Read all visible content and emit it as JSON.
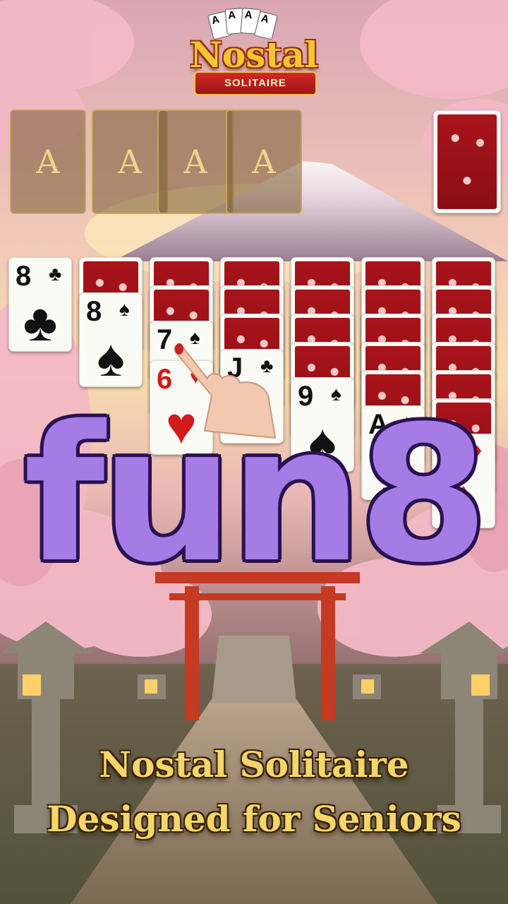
{
  "logo": {
    "title": "Nostal",
    "subtitle": "SOLITAIRE",
    "mini_cards": [
      "A",
      "A",
      "A",
      "A"
    ]
  },
  "foundations": [
    "A",
    "A",
    "A",
    "A"
  ],
  "stock": {
    "face": "back"
  },
  "tableau": [
    {
      "hidden": 0,
      "cards": [
        {
          "rank": "8",
          "suit": "♣",
          "color": "black"
        }
      ]
    },
    {
      "hidden": 1,
      "cards": [
        {
          "rank": "8",
          "suit": "♠",
          "color": "black"
        }
      ]
    },
    {
      "hidden": 2,
      "cards": [
        {
          "rank": "7",
          "suit": "♠",
          "color": "black"
        },
        {
          "rank": "6",
          "suit": "♥",
          "color": "red"
        }
      ]
    },
    {
      "hidden": 3,
      "cards": [
        {
          "rank": "J",
          "suit": "♣",
          "color": "black"
        }
      ]
    },
    {
      "hidden": 4,
      "cards": [
        {
          "rank": "9",
          "suit": "♠",
          "color": "black"
        }
      ]
    },
    {
      "hidden": 5,
      "cards": [
        {
          "rank": "A",
          "suit": "♠",
          "color": "black"
        }
      ]
    },
    {
      "hidden": 6,
      "cards": [
        {
          "rank": "8",
          "suit": "♦",
          "color": "red"
        }
      ]
    }
  ],
  "overlay_text": "fun8",
  "tagline": {
    "line1": "Nostal Solitaire",
    "line2": "Designed for Seniors"
  },
  "colors": {
    "sky_top": "#e9b7b4",
    "sky_horizon": "#f7d7a8",
    "blossom": "#f3b9c6",
    "torii": "#c43a22",
    "overlay_fill": "#a57be6",
    "tagline_gold": "#f4d66a"
  }
}
